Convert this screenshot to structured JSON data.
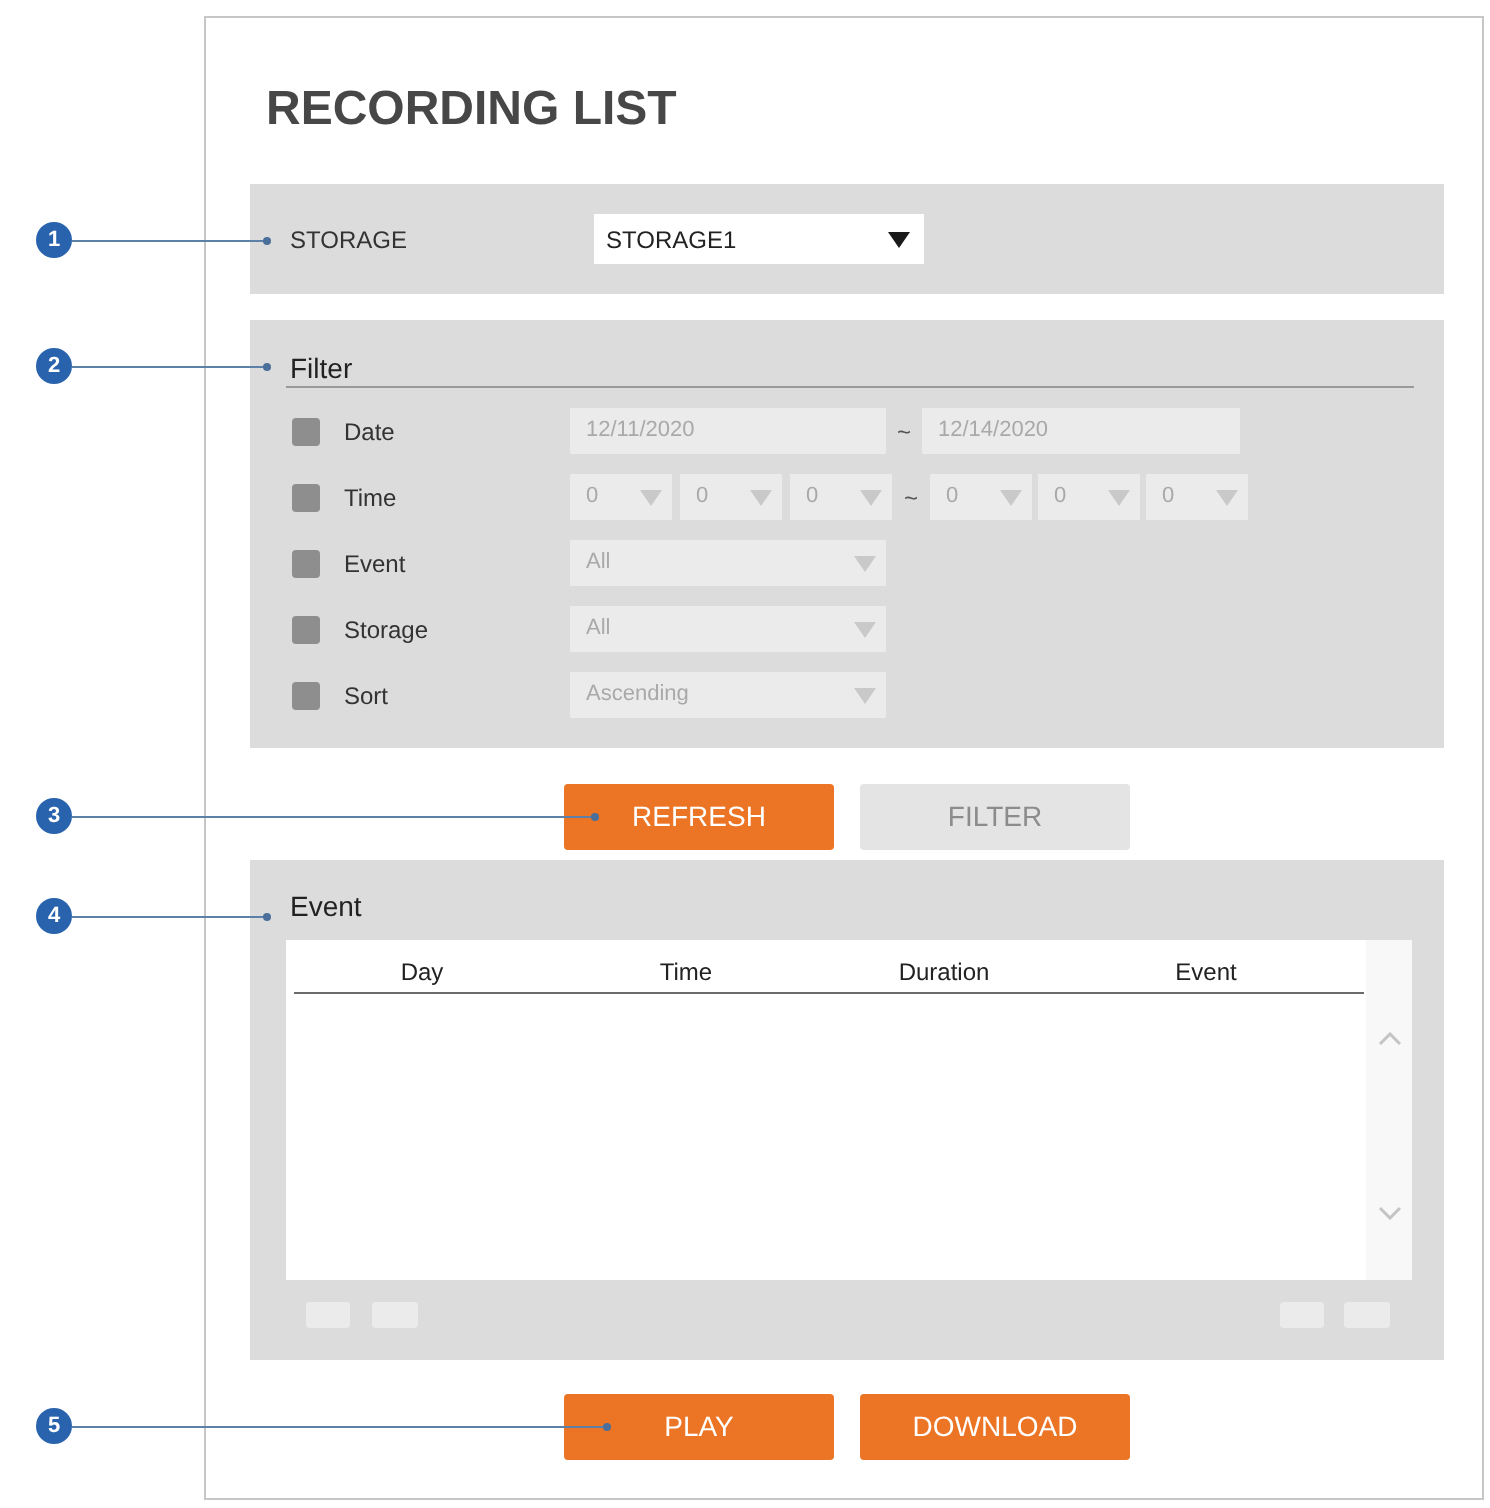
{
  "title": "RECORDING LIST",
  "storage": {
    "label": "STORAGE",
    "value": "STORAGE1"
  },
  "filter": {
    "heading": "Filter",
    "rows": [
      {
        "kind": "date",
        "label": "Date",
        "checked": false,
        "from": "12/11/2020",
        "separator": "~",
        "to": "12/14/2020"
      },
      {
        "kind": "time",
        "label": "Time",
        "checked": false,
        "from": [
          "0",
          "0",
          "0"
        ],
        "separator": "~",
        "to": [
          "0",
          "0",
          "0"
        ]
      },
      {
        "kind": "select",
        "label": "Event",
        "checked": false,
        "value": "All"
      },
      {
        "kind": "select",
        "label": "Storage",
        "checked": false,
        "value": "All"
      },
      {
        "kind": "select",
        "label": "Sort",
        "checked": false,
        "value": "Ascending"
      }
    ]
  },
  "actions": [
    {
      "label": "REFRESH",
      "disabled": false
    },
    {
      "label": "FILTER",
      "disabled": true
    }
  ],
  "event_list": {
    "heading": "Event",
    "columns": [
      "Day",
      "Time",
      "Duration",
      "Event"
    ]
  },
  "bottom_buttons": [
    {
      "label": "PLAY"
    },
    {
      "label": "DOWNLOAD"
    }
  ],
  "callouts": [
    "1",
    "2",
    "3",
    "4",
    "5"
  ]
}
